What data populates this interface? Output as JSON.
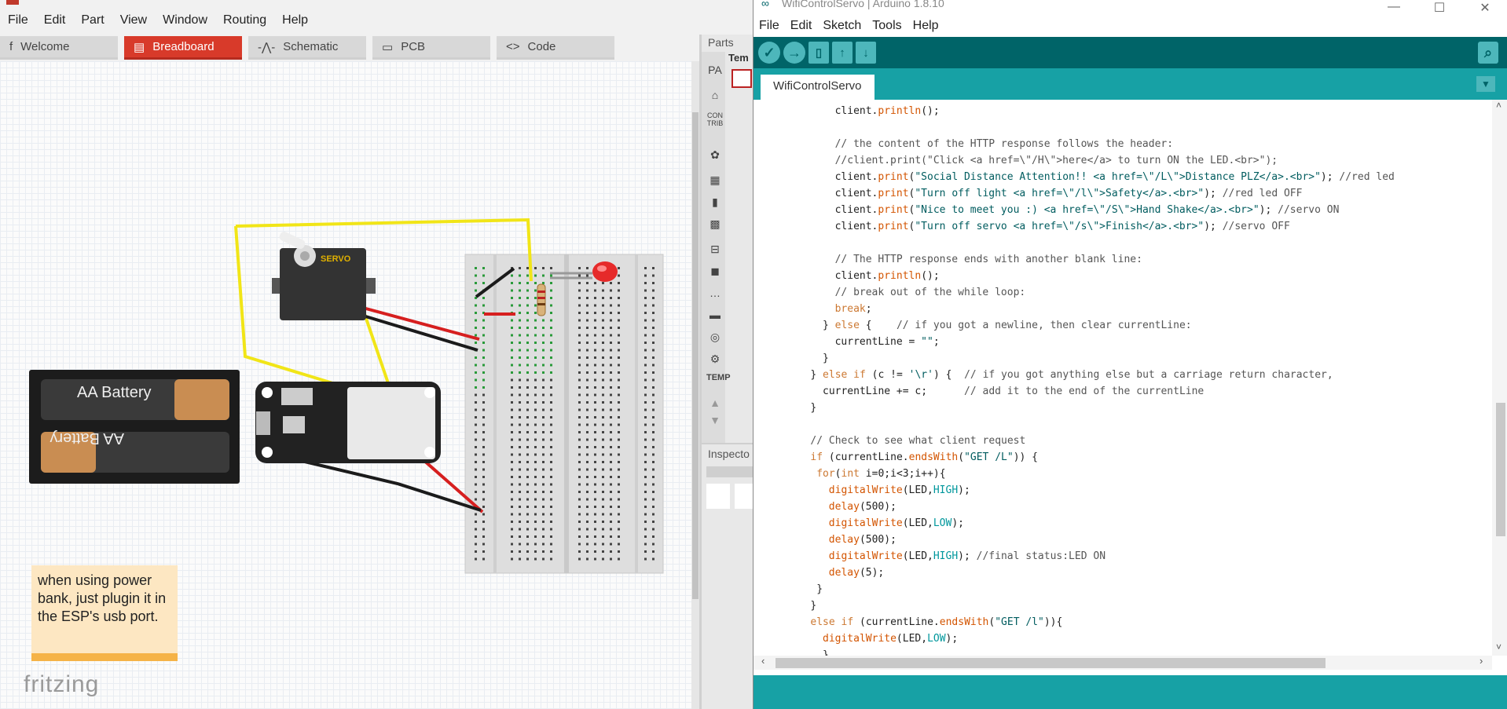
{
  "fritzing": {
    "menu": [
      "File",
      "Edit",
      "Part",
      "View",
      "Window",
      "Routing",
      "Help"
    ],
    "tabs": [
      {
        "icon": "f",
        "label": "Welcome"
      },
      {
        "icon": "▤",
        "label": "Breadboard"
      },
      {
        "icon": "-⋀-",
        "label": "Schematic"
      },
      {
        "icon": "▭",
        "label": "PCB"
      },
      {
        "icon": "<>",
        "label": "Code"
      }
    ],
    "parts_label": "Parts",
    "temp_label": "TEMP",
    "temp_tab": "Tem",
    "contrib_label": "CON TRIB",
    "inspector_label": "Inspecto",
    "servo_label": "SERVO",
    "battery_label_1": "AA Battery",
    "battery_label_2": "AA Battery",
    "note_text": "when using power bank, just plugin it in the ESP's usb port.",
    "logo": "fritzing"
  },
  "arduino": {
    "title": "WifiControlServo | Arduino 1.8.10",
    "menu": [
      "File",
      "Edit",
      "Sketch",
      "Tools",
      "Help"
    ],
    "tab": "WifiControlServo",
    "code_lines": [
      {
        "indent": 12,
        "parts": [
          [
            "",
            "client."
          ],
          [
            "fn",
            "println"
          ],
          [
            "",
            "();"
          ]
        ]
      },
      {
        "indent": 0,
        "parts": []
      },
      {
        "indent": 12,
        "parts": [
          [
            "cm",
            "// the content of the HTTP response follows the header:"
          ]
        ]
      },
      {
        "indent": 12,
        "parts": [
          [
            "cm",
            "//client.print(\"Click <a href=\\\"/H\\\">here</a> to turn ON the LED.<br>\");"
          ]
        ]
      },
      {
        "indent": 12,
        "parts": [
          [
            "",
            "client."
          ],
          [
            "fn",
            "print"
          ],
          [
            "",
            "("
          ],
          [
            "str",
            "\"Social Distance Attention!! <a href=\\\"/L\\\">Distance PLZ</a>.<br>\""
          ],
          [
            "",
            "); "
          ],
          [
            "cm",
            "//red led"
          ]
        ]
      },
      {
        "indent": 12,
        "parts": [
          [
            "",
            "client."
          ],
          [
            "fn",
            "print"
          ],
          [
            "",
            "("
          ],
          [
            "str",
            "\"Turn off light <a href=\\\"/l\\\">Safety</a>.<br>\""
          ],
          [
            "",
            "); "
          ],
          [
            "cm",
            "//red led OFF"
          ]
        ]
      },
      {
        "indent": 12,
        "parts": [
          [
            "",
            "client."
          ],
          [
            "fn",
            "print"
          ],
          [
            "",
            "("
          ],
          [
            "str",
            "\"Nice to meet you :) <a href=\\\"/S\\\">Hand Shake</a>.<br>\""
          ],
          [
            "",
            "); "
          ],
          [
            "cm",
            "//servo ON"
          ]
        ]
      },
      {
        "indent": 12,
        "parts": [
          [
            "",
            "client."
          ],
          [
            "fn",
            "print"
          ],
          [
            "",
            "("
          ],
          [
            "str",
            "\"Turn off servo <a href=\\\"/s\\\">Finish</a>.<br>\""
          ],
          [
            "",
            "); "
          ],
          [
            "cm",
            "//servo OFF"
          ]
        ]
      },
      {
        "indent": 0,
        "parts": []
      },
      {
        "indent": 12,
        "parts": [
          [
            "cm",
            "// The HTTP response ends with another blank line:"
          ]
        ]
      },
      {
        "indent": 12,
        "parts": [
          [
            "",
            "client."
          ],
          [
            "fn",
            "println"
          ],
          [
            "",
            "();"
          ]
        ]
      },
      {
        "indent": 12,
        "parts": [
          [
            "cm",
            "// break out of the while loop:"
          ]
        ]
      },
      {
        "indent": 12,
        "parts": [
          [
            "kw",
            "break"
          ],
          [
            "",
            ";"
          ]
        ]
      },
      {
        "indent": 10,
        "parts": [
          [
            "",
            "} "
          ],
          [
            "kw",
            "else"
          ],
          [
            "",
            " {    "
          ],
          [
            "cm",
            "// if you got a newline, then clear currentLine:"
          ]
        ]
      },
      {
        "indent": 12,
        "parts": [
          [
            "",
            "currentLine = "
          ],
          [
            "str",
            "\"\""
          ],
          [
            "",
            ";"
          ]
        ]
      },
      {
        "indent": 10,
        "parts": [
          [
            "",
            "}"
          ]
        ]
      },
      {
        "indent": 8,
        "parts": [
          [
            "",
            "} "
          ],
          [
            "kw",
            "else if"
          ],
          [
            "",
            " (c != "
          ],
          [
            "str",
            "'\\r'"
          ],
          [
            "",
            ") {  "
          ],
          [
            "cm",
            "// if you got anything else but a carriage return character,"
          ]
        ]
      },
      {
        "indent": 10,
        "parts": [
          [
            "",
            "currentLine += c;      "
          ],
          [
            "cm",
            "// add it to the end of the currentLine"
          ]
        ]
      },
      {
        "indent": 8,
        "parts": [
          [
            "",
            "}"
          ]
        ]
      },
      {
        "indent": 0,
        "parts": []
      },
      {
        "indent": 8,
        "parts": [
          [
            "cm",
            "// Check to see what client request"
          ]
        ]
      },
      {
        "indent": 8,
        "parts": [
          [
            "kw",
            "if"
          ],
          [
            "",
            " (currentLine."
          ],
          [
            "fn",
            "endsWith"
          ],
          [
            "",
            "("
          ],
          [
            "str",
            "\"GET /L\""
          ],
          [
            "",
            ")) {"
          ]
        ]
      },
      {
        "indent": 9,
        "parts": [
          [
            "kw",
            "for"
          ],
          [
            "",
            "("
          ],
          [
            "kw",
            "int"
          ],
          [
            "",
            " i=0;i<3;i++){"
          ]
        ]
      },
      {
        "indent": 11,
        "parts": [
          [
            "fn",
            "digitalWrite"
          ],
          [
            "",
            "(LED,"
          ],
          [
            "cst",
            "HIGH"
          ],
          [
            "",
            ");"
          ]
        ]
      },
      {
        "indent": 11,
        "parts": [
          [
            "fn",
            "delay"
          ],
          [
            "",
            "(500);"
          ]
        ]
      },
      {
        "indent": 11,
        "parts": [
          [
            "fn",
            "digitalWrite"
          ],
          [
            "",
            "(LED,"
          ],
          [
            "cst",
            "LOW"
          ],
          [
            "",
            ");"
          ]
        ]
      },
      {
        "indent": 11,
        "parts": [
          [
            "fn",
            "delay"
          ],
          [
            "",
            "(500);"
          ]
        ]
      },
      {
        "indent": 11,
        "parts": [
          [
            "fn",
            "digitalWrite"
          ],
          [
            "",
            "(LED,"
          ],
          [
            "cst",
            "HIGH"
          ],
          [
            "",
            "); "
          ],
          [
            "cm",
            "//final status:LED ON"
          ]
        ]
      },
      {
        "indent": 11,
        "parts": [
          [
            "fn",
            "delay"
          ],
          [
            "",
            "(5);"
          ]
        ]
      },
      {
        "indent": 9,
        "parts": [
          [
            "",
            "}"
          ]
        ]
      },
      {
        "indent": 8,
        "parts": [
          [
            "",
            "}"
          ]
        ]
      },
      {
        "indent": 8,
        "parts": [
          [
            "kw",
            "else if"
          ],
          [
            "",
            " (currentLine."
          ],
          [
            "fn",
            "endsWith"
          ],
          [
            "",
            "("
          ],
          [
            "str",
            "\"GET /l\""
          ],
          [
            "",
            "))"
          ],
          [
            "",
            "{"
          ]
        ]
      },
      {
        "indent": 10,
        "parts": [
          [
            "fn",
            "digitalWrite"
          ],
          [
            "",
            "(LED,"
          ],
          [
            "cst",
            "LOW"
          ],
          [
            "",
            ");"
          ]
        ]
      },
      {
        "indent": 10,
        "parts": [
          [
            "",
            "}"
          ]
        ]
      }
    ]
  }
}
